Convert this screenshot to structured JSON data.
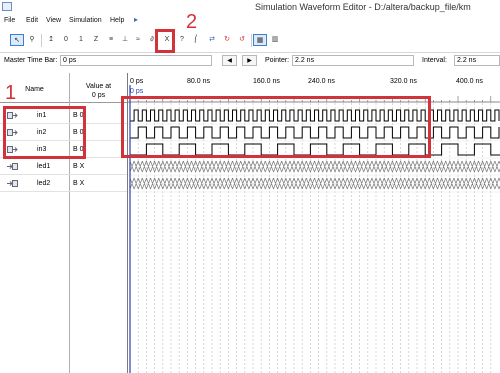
{
  "window": {
    "title": "Simulation Waveform Editor - D:/altera/backup_file/km"
  },
  "menu": {
    "items": [
      "File",
      "Edit",
      "View",
      "Simulation",
      "Help"
    ]
  },
  "toolbar": {
    "buttons": [
      "selection-tool",
      "zoom-tool",
      "node-finder",
      "forcing-low",
      "forcing-high",
      "invert",
      "arbitrary-value",
      "clock",
      "count-value",
      "random-value",
      "weak-low",
      "weak-high",
      "forcing-unknown",
      "high-impedance",
      "dont-care",
      "invert-selection",
      "run-functional-simulation",
      "run-timing-simulation",
      "snap-to-grid",
      "grid"
    ]
  },
  "controls": {
    "master_time_bar_label": "Master Time Bar:",
    "master_time_bar_value": "0 ps",
    "pointer_label": "Pointer:",
    "pointer_value": "2.2 ns",
    "interval_label": "Interval:",
    "interval_value": "2.2 ns"
  },
  "signal_table": {
    "name_header": "Name",
    "value_header_line1": "Value at",
    "value_header_line2": "0 ps",
    "rows": [
      {
        "name": "in1",
        "value": "B 0",
        "type": "input"
      },
      {
        "name": "in2",
        "value": "B 0",
        "type": "input"
      },
      {
        "name": "in3",
        "value": "B 0",
        "type": "input"
      },
      {
        "name": "led1",
        "value": "B X",
        "type": "output"
      },
      {
        "name": "led2",
        "value": "B X",
        "type": "output"
      }
    ]
  },
  "ruler": {
    "labels": [
      "0 ps",
      "80.0 ns",
      "160.0 ns",
      "240.0 ns",
      "320.0 ns",
      "400.0 ns"
    ],
    "cursor_label": "0 ps"
  },
  "annotations": {
    "label_1": "1",
    "label_2": "2"
  },
  "colors": {
    "highlight": "#d2333a",
    "cursor": "#2d3fb4",
    "grid": "#bdbdbd"
  }
}
